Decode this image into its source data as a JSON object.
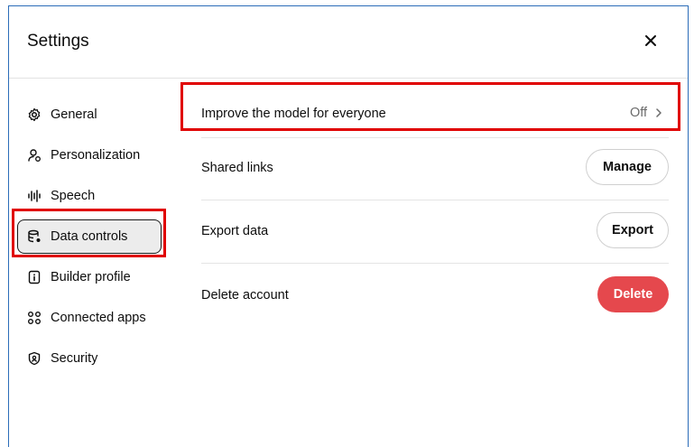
{
  "dialog": {
    "title": "Settings"
  },
  "sidebar": {
    "items": [
      {
        "label": "General",
        "icon": "gear-icon"
      },
      {
        "label": "Personalization",
        "icon": "person-icon"
      },
      {
        "label": "Speech",
        "icon": "waveform-icon"
      },
      {
        "label": "Data controls",
        "icon": "database-icon",
        "active": true
      },
      {
        "label": "Builder profile",
        "icon": "id-card-icon"
      },
      {
        "label": "Connected apps",
        "icon": "apps-grid-icon"
      },
      {
        "label": "Security",
        "icon": "shield-icon"
      }
    ]
  },
  "main": {
    "improve_model": {
      "label": "Improve the model for everyone",
      "value": "Off"
    },
    "shared_links": {
      "label": "Shared links",
      "button": "Manage"
    },
    "export_data": {
      "label": "Export data",
      "button": "Export"
    },
    "delete_account": {
      "label": "Delete account",
      "button": "Delete"
    }
  },
  "colors": {
    "highlight": "#e00000",
    "danger": "#e5484d",
    "dialog_border": "#2b6cb8"
  }
}
